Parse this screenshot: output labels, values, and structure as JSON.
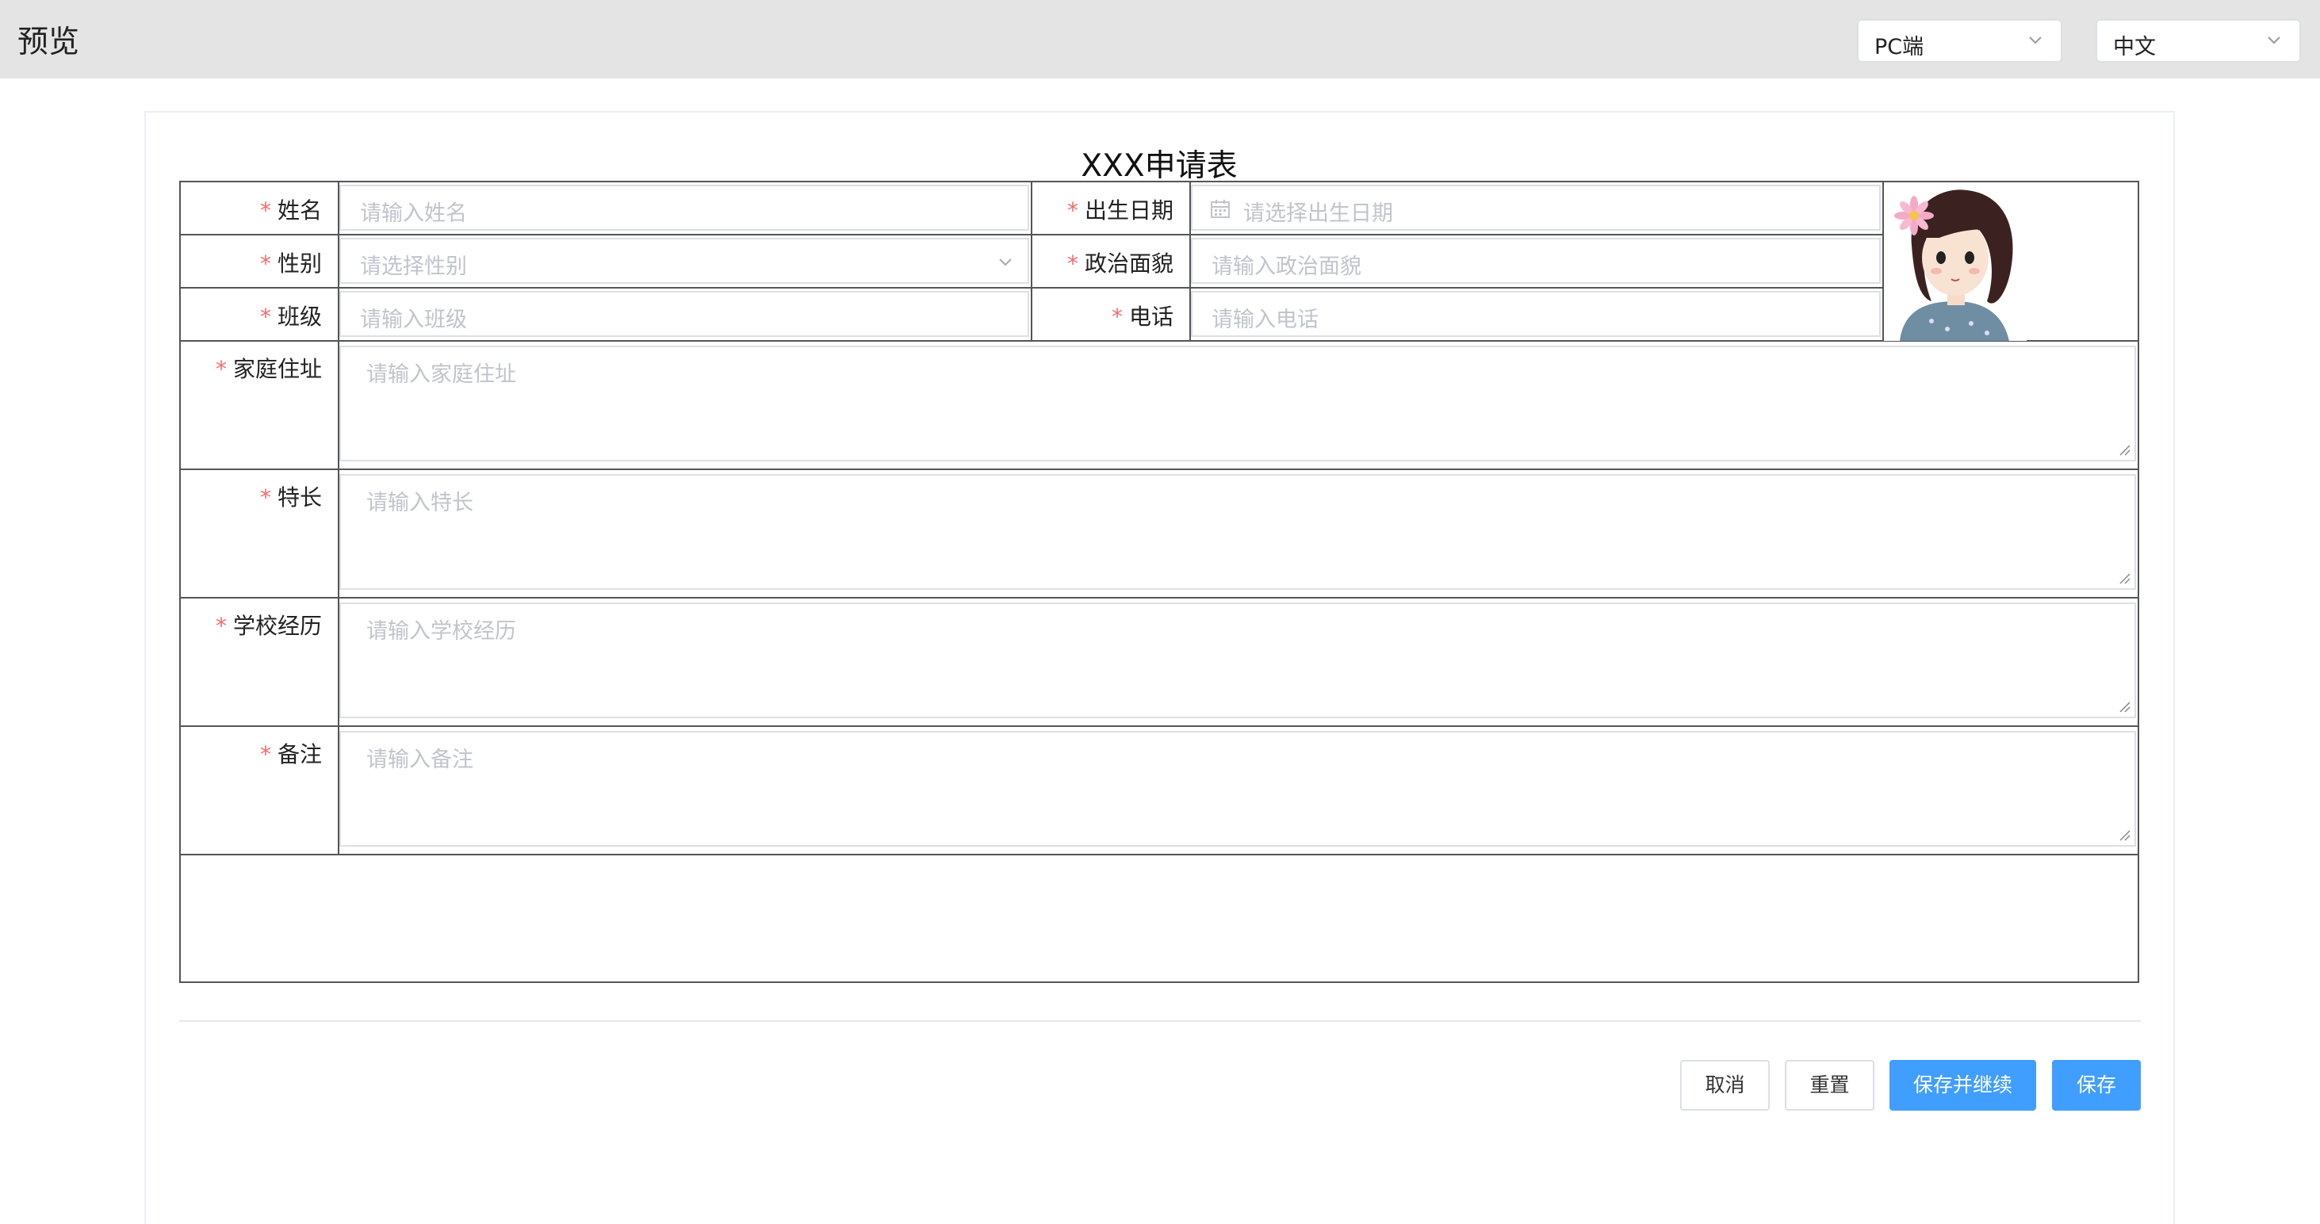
{
  "header": {
    "title": "预览",
    "device_select": "PC端",
    "language_select": "中文"
  },
  "form": {
    "title": "XXX申请表",
    "required_mark": "*",
    "fields": {
      "name": {
        "label": "姓名",
        "placeholder": "请输入姓名"
      },
      "birthdate": {
        "label": "出生日期",
        "placeholder": "请选择出生日期"
      },
      "gender": {
        "label": "性别",
        "placeholder": "请选择性别"
      },
      "political": {
        "label": "政治面貌",
        "placeholder": "请输入政治面貌"
      },
      "class": {
        "label": "班级",
        "placeholder": "请输入班级"
      },
      "phone": {
        "label": "电话",
        "placeholder": "请输入电话"
      },
      "address": {
        "label": "家庭住址",
        "placeholder": "请输入家庭住址"
      },
      "specialty": {
        "label": "特长",
        "placeholder": "请输入特长"
      },
      "school_history": {
        "label": "学校经历",
        "placeholder": "请输入学校经历"
      },
      "remarks": {
        "label": "备注",
        "placeholder": "请输入备注"
      }
    }
  },
  "actions": {
    "cancel": "取消",
    "reset": "重置",
    "save_continue": "保存并继续",
    "save": "保存"
  },
  "colors": {
    "primary": "#409eff",
    "required": "#f56c6c",
    "header_bg": "#e4e4e4",
    "placeholder": "#c0c4cc"
  },
  "icons": [
    "chevron-down-icon",
    "calendar-icon",
    "resize-grip-icon"
  ]
}
